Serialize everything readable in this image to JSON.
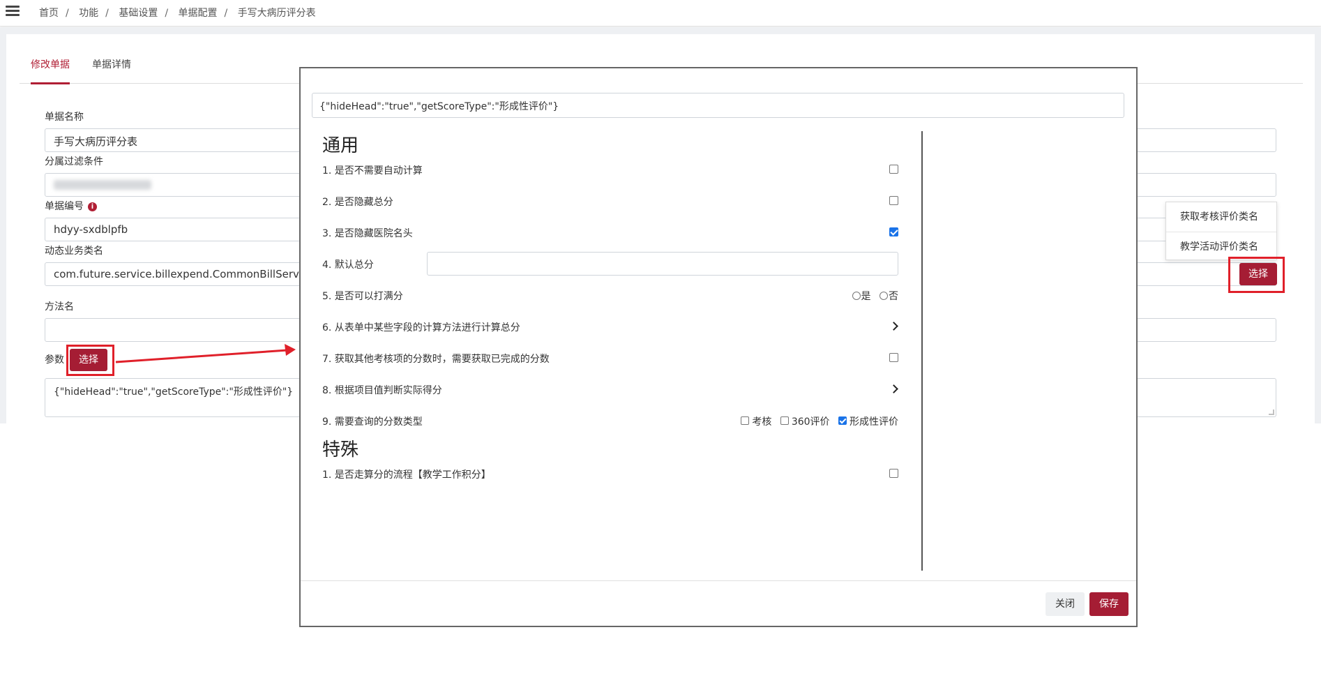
{
  "breadcrumb": [
    "首页",
    "功能",
    "基础设置",
    "单据配置",
    "手写大病历评分表"
  ],
  "tabs": {
    "edit": "修改单据",
    "detail": "单据详情"
  },
  "form": {
    "bill_name_label": "单据名称",
    "bill_name_value": "手写大病历评分表",
    "filter_label": "分属过滤条件",
    "bill_code_label": "单据编号",
    "bill_code_value": "hdyy-sxdblpfb",
    "biz_class_label": "动态业务类名",
    "biz_class_value": "com.future.service.billexpend.CommonBillService",
    "method_label": "方法名",
    "param_label": "参数",
    "param_select": "选择",
    "param_value": "{\"hideHead\":\"true\",\"getScoreType\":\"形成性评价\"}",
    "method_select": "选择"
  },
  "dropdown": [
    "获取考核评价类名",
    "教学活动评价类名"
  ],
  "modal": {
    "param_value": "{\"hideHead\":\"true\",\"getScoreType\":\"形成性评价\"}",
    "general_title": "通用",
    "special_title": "特殊",
    "general_items": [
      "1. 是否不需要自动计算",
      "2. 是否隐藏总分",
      "3. 是否隐藏医院名头",
      "4. 默认总分",
      "5. 是否可以打满分",
      "6. 从表单中某些字段的计算方法进行计算总分",
      "7. 获取其他考核项的分数时，需要获取已完成的分数",
      "8. 根据项目值判断实际得分",
      "9. 需要查询的分数类型"
    ],
    "general_checked": [
      false,
      false,
      true
    ],
    "item7_checked": false,
    "full_score_options": [
      "是",
      "否"
    ],
    "score_types": [
      "考核",
      "360评价",
      "形成性评价"
    ],
    "score_types_checked": [
      false,
      false,
      true
    ],
    "special_items": [
      "1. 是否走算分的流程【教学工作积分】"
    ],
    "special_checked": [
      false
    ],
    "close_label": "关闭",
    "save_label": "保存"
  },
  "colors": {
    "accent": "#a51d34",
    "annotation": "#e0202a",
    "checkbox": "#1a73e8"
  }
}
